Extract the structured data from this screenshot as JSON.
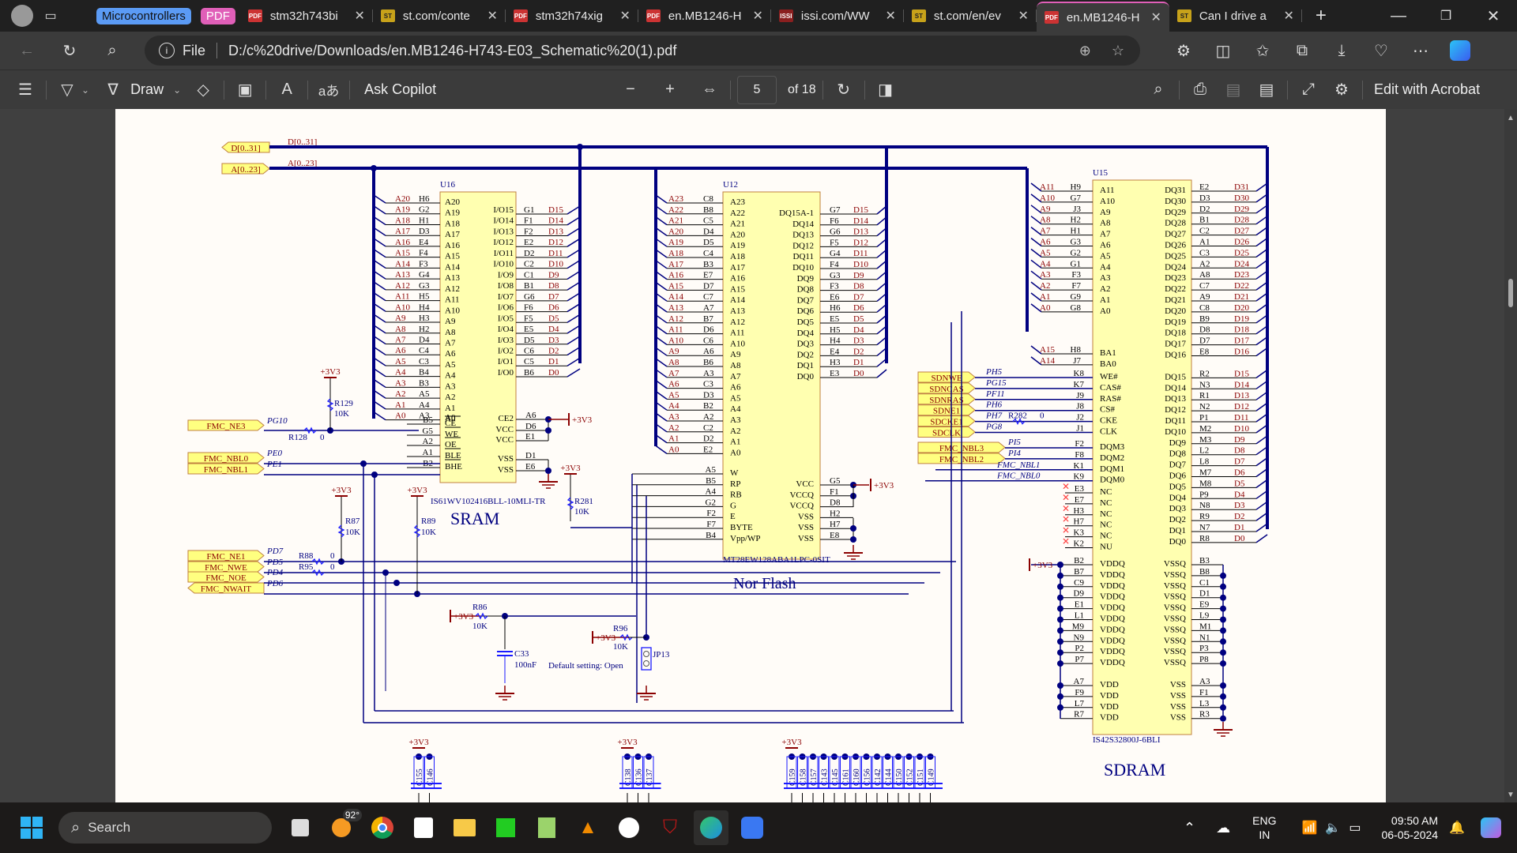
{
  "browser": {
    "tab_groups": [
      {
        "label": "Microcontrollers",
        "color": "#5b9bf5"
      },
      {
        "label": "PDF",
        "color": "#e05fb8"
      }
    ],
    "tabs": [
      {
        "title": "stm32h743bi",
        "icon": "pdf-icon",
        "active": false
      },
      {
        "title": "st.com/conte",
        "icon": "st-logo-icon",
        "active": false
      },
      {
        "title": "stm32h74xig",
        "icon": "pdf-icon",
        "active": false
      },
      {
        "title": "en.MB1246-H",
        "icon": "pdf-icon",
        "active": false
      },
      {
        "title": "issi.com/WW",
        "icon": "issi-logo-icon",
        "active": false
      },
      {
        "title": "st.com/en/ev",
        "icon": "st-logo-icon",
        "active": false
      },
      {
        "title": "en.MB1246-H",
        "icon": "pdf-icon",
        "active": true
      },
      {
        "title": "Can I drive a",
        "icon": "st-logo-icon",
        "active": false
      }
    ],
    "address": {
      "scheme_label": "File",
      "url": "D:/c%20drive/Downloads/en.MB1246-H743-E03_Schematic%20(1).pdf"
    }
  },
  "pdf_toolbar": {
    "draw_label": "Draw",
    "ask_copilot_label": "Ask Copilot",
    "page_current": "5",
    "page_total_label": "of 18",
    "edit_label": "Edit with Acrobat"
  },
  "schematic": {
    "bus_ports": {
      "data": "D[0..31]",
      "addr": "A[0..23]"
    },
    "sram": {
      "ref": "U16",
      "part": "IS61WV102416BLL-10MLI-TR",
      "title": "SRAM",
      "addr_pins": [
        [
          "A20",
          "H6"
        ],
        [
          "A19",
          "G2"
        ],
        [
          "A18",
          "H1"
        ],
        [
          "A17",
          "D3"
        ],
        [
          "A16",
          "E4"
        ],
        [
          "A15",
          "F4"
        ],
        [
          "A14",
          "F3"
        ],
        [
          "A13",
          "G4"
        ],
        [
          "A12",
          "G3"
        ],
        [
          "A11",
          "H5"
        ],
        [
          "A10",
          "H4"
        ],
        [
          "A9",
          "H3"
        ],
        [
          "A8",
          "H2"
        ],
        [
          "A7",
          "D4"
        ],
        [
          "A6",
          "C4"
        ],
        [
          "A5",
          "C3"
        ],
        [
          "A4",
          "B4"
        ],
        [
          "A3",
          "B3"
        ],
        [
          "A2",
          "A5"
        ],
        [
          "A1",
          "A4"
        ],
        [
          "A0",
          "A3"
        ]
      ],
      "data_pins": [
        [
          "I/O15",
          "G1",
          "D15"
        ],
        [
          "I/O14",
          "F1",
          "D14"
        ],
        [
          "I/O13",
          "F2",
          "D13"
        ],
        [
          "I/O12",
          "E2",
          "D12"
        ],
        [
          "I/O11",
          "D2",
          "D11"
        ],
        [
          "I/O10",
          "C2",
          "D10"
        ],
        [
          "I/O9",
          "C1",
          "D9"
        ],
        [
          "I/O8",
          "B1",
          "D8"
        ],
        [
          "I/O7",
          "G6",
          "D7"
        ],
        [
          "I/O6",
          "F6",
          "D6"
        ],
        [
          "I/O5",
          "F5",
          "D5"
        ],
        [
          "I/O4",
          "E5",
          "D4"
        ],
        [
          "I/O3",
          "D5",
          "D3"
        ],
        [
          "I/O2",
          "C6",
          "D2"
        ],
        [
          "I/O1",
          "C5",
          "D1"
        ],
        [
          "I/O0",
          "B6",
          "D0"
        ]
      ],
      "ctrl_pins": [
        [
          "CE",
          "B5"
        ],
        [
          "WE",
          "G5"
        ],
        [
          "OE",
          "A2"
        ],
        [
          "BLE",
          "A1"
        ],
        [
          "BHE",
          "B2"
        ]
      ],
      "pwr_pins": [
        [
          "CE2",
          "A6"
        ],
        [
          "VCC",
          "D6"
        ],
        [
          "VCC",
          "E1"
        ],
        [
          "VSS",
          "D1"
        ],
        [
          "VSS",
          "E6"
        ]
      ]
    },
    "nor": {
      "ref": "U12",
      "part": "MT28EW128ABA1LPC-0SIT",
      "title": "Nor Flash",
      "addr_pins": [
        [
          "A23",
          "C8"
        ],
        [
          "A22",
          "B8"
        ],
        [
          "A21",
          "C5"
        ],
        [
          "A20",
          "D4"
        ],
        [
          "A19",
          "D5"
        ],
        [
          "A18",
          "C4"
        ],
        [
          "A17",
          "B3"
        ],
        [
          "A16",
          "E7"
        ],
        [
          "A15",
          "D7"
        ],
        [
          "A14",
          "C7"
        ],
        [
          "A13",
          "A7"
        ],
        [
          "A12",
          "B7"
        ],
        [
          "A11",
          "D6"
        ],
        [
          "A10",
          "C6"
        ],
        [
          "A9",
          "A6"
        ],
        [
          "A8",
          "B6"
        ],
        [
          "A7",
          "A3"
        ],
        [
          "A6",
          "C3"
        ],
        [
          "A5",
          "D3"
        ],
        [
          "A4",
          "B2"
        ],
        [
          "A3",
          "A2"
        ],
        [
          "A2",
          "C2"
        ],
        [
          "A1",
          "D2"
        ],
        [
          "A0",
          "E2"
        ]
      ],
      "data_pins": [
        [
          "DQ15A-1",
          "G7",
          "D15"
        ],
        [
          "DQ14",
          "F6",
          "D14"
        ],
        [
          "DQ13",
          "G6",
          "D13"
        ],
        [
          "DQ12",
          "F5",
          "D12"
        ],
        [
          "DQ11",
          "G4",
          "D11"
        ],
        [
          "DQ10",
          "F4",
          "D10"
        ],
        [
          "DQ9",
          "G3",
          "D9"
        ],
        [
          "DQ8",
          "F3",
          "D8"
        ],
        [
          "DQ7",
          "E6",
          "D7"
        ],
        [
          "DQ6",
          "H6",
          "D6"
        ],
        [
          "DQ5",
          "E5",
          "D5"
        ],
        [
          "DQ4",
          "H5",
          "D4"
        ],
        [
          "DQ3",
          "H4",
          "D3"
        ],
        [
          "DQ2",
          "E4",
          "D2"
        ],
        [
          "DQ1",
          "H3",
          "D1"
        ],
        [
          "DQ0",
          "E3",
          "D0"
        ]
      ],
      "ctrl_pins": [
        [
          "W",
          "A5"
        ],
        [
          "RP",
          "B5"
        ],
        [
          "RB",
          "A4"
        ],
        [
          "G",
          "G2"
        ],
        [
          "E",
          "F2"
        ],
        [
          "BYTE",
          "F7"
        ],
        [
          "Vpp/WP",
          "B4"
        ]
      ],
      "pwr_pins": [
        [
          "VCC",
          "G5"
        ],
        [
          "VCCQ",
          "F1"
        ],
        [
          "VCCQ",
          "D8"
        ],
        [
          "VSS",
          "H2"
        ],
        [
          "VSS",
          "H7"
        ],
        [
          "VSS",
          "E8"
        ]
      ]
    },
    "sdram": {
      "ref": "U15",
      "part": "IS42S32800J-6BLI",
      "title": "SDRAM",
      "addr_pins": [
        [
          "A11",
          "H9"
        ],
        [
          "A10",
          "G7"
        ],
        [
          "A9",
          "J3"
        ],
        [
          "A8",
          "H2"
        ],
        [
          "A7",
          "H1"
        ],
        [
          "A6",
          "G3"
        ],
        [
          "A5",
          "G2"
        ],
        [
          "A4",
          "G1"
        ],
        [
          "A3",
          "F3"
        ],
        [
          "A2",
          "F7"
        ],
        [
          "A1",
          "G9"
        ],
        [
          "A0",
          "G8"
        ]
      ],
      "bank_pins": [
        [
          "BA1",
          "H8",
          "A15"
        ],
        [
          "BA0",
          "J7",
          "A14"
        ]
      ],
      "data_pins": [
        [
          "DQ31",
          "E2",
          "D31"
        ],
        [
          "DQ30",
          "D3",
          "D30"
        ],
        [
          "DQ29",
          "D2",
          "D29"
        ],
        [
          "DQ28",
          "B1",
          "D28"
        ],
        [
          "DQ27",
          "C2",
          "D27"
        ],
        [
          "DQ26",
          "A1",
          "D26"
        ],
        [
          "DQ25",
          "C3",
          "D25"
        ],
        [
          "DQ24",
          "A2",
          "D24"
        ],
        [
          "DQ23",
          "A8",
          "D23"
        ],
        [
          "DQ22",
          "C7",
          "D22"
        ],
        [
          "DQ21",
          "A9",
          "D21"
        ],
        [
          "DQ20",
          "C8",
          "D20"
        ],
        [
          "DQ19",
          "B9",
          "D19"
        ],
        [
          "DQ18",
          "D8",
          "D18"
        ],
        [
          "DQ17",
          "D7",
          "D17"
        ],
        [
          "DQ16",
          "E8",
          "D16"
        ],
        [
          "DQ15",
          "R2",
          "D15"
        ],
        [
          "DQ14",
          "N3",
          "D14"
        ],
        [
          "DQ13",
          "R1",
          "D13"
        ],
        [
          "DQ12",
          "N2",
          "D12"
        ],
        [
          "DQ11",
          "P1",
          "D11"
        ],
        [
          "DQ10",
          "M2",
          "D10"
        ],
        [
          "DQ9",
          "M3",
          "D9"
        ],
        [
          "DQ8",
          "L2",
          "D8"
        ],
        [
          "DQ7",
          "L8",
          "D7"
        ],
        [
          "DQ6",
          "M7",
          "D6"
        ],
        [
          "DQ5",
          "M8",
          "D5"
        ],
        [
          "DQ4",
          "P9",
          "D4"
        ],
        [
          "DQ3",
          "N8",
          "D3"
        ],
        [
          "DQ2",
          "R9",
          "D2"
        ],
        [
          "DQ1",
          "N7",
          "D1"
        ],
        [
          "DQ0",
          "R8",
          "D0"
        ]
      ],
      "ctrl_pins": [
        [
          "WE#",
          "K8",
          "SDNWE",
          "PH5"
        ],
        [
          "CAS#",
          "K7",
          "SDNCAS",
          "PG15"
        ],
        [
          "RAS#",
          "J9",
          "SDNRAS",
          "PF11"
        ],
        [
          "CS#",
          "J8",
          "SDNE1",
          "PH6"
        ],
        [
          "CKE",
          "J2",
          "SDCKE1",
          "PH7"
        ],
        [
          "CLK",
          "J1",
          "SDCLK",
          "PG8"
        ]
      ],
      "dqm_pins": [
        [
          "DQM3",
          "F2",
          "FMC_NBL3",
          "PI5"
        ],
        [
          "DQM2",
          "F8",
          "FMC_NBL2",
          "PI4"
        ],
        [
          "DQM1",
          "K1",
          "FMC_NBL1",
          ""
        ],
        [
          "DQM0",
          "K9",
          "FMC_NBL0",
          ""
        ]
      ],
      "nc_pins": [
        [
          "NC",
          "E3"
        ],
        [
          "NC",
          "E7"
        ],
        [
          "NC",
          "H3"
        ],
        [
          "NC",
          "H7"
        ],
        [
          "NC",
          "K3"
        ],
        [
          "NU",
          "K2"
        ]
      ],
      "vddq_pins": [
        "B2",
        "B7",
        "C9",
        "D9",
        "E1",
        "L1",
        "M9",
        "N9",
        "P2",
        "P7"
      ],
      "vssq_pins": [
        "B3",
        "B8",
        "C1",
        "D1",
        "E9",
        "L9",
        "M1",
        "N1",
        "P3",
        "P8"
      ],
      "vdd_pins": [
        "A7",
        "F9",
        "L7",
        "R7"
      ],
      "vss_pins": [
        "A3",
        "F1",
        "L3",
        "R3"
      ]
    },
    "ports": [
      {
        "label": "FMC_NE3",
        "pin": "PG10"
      },
      {
        "label": "FMC_NBL0",
        "pin": "PE0"
      },
      {
        "label": "FMC_NBL1",
        "pin": "PE1"
      },
      {
        "label": "FMC_NE1",
        "pin": "PD7"
      },
      {
        "label": "FMC_NWE",
        "pin": "PD5"
      },
      {
        "label": "FMC_NOE",
        "pin": "PD4"
      },
      {
        "label": "FMC_NWAIT",
        "pin": "PD6"
      }
    ],
    "passives": {
      "r128": {
        "ref": "R128",
        "value": "0"
      },
      "r129": {
        "ref": "R129",
        "value": "10K"
      },
      "r87": {
        "ref": "R87",
        "value": "10K"
      },
      "r89": {
        "ref": "R89",
        "value": "10K"
      },
      "r88": {
        "ref": "R88",
        "value": "0"
      },
      "r95": {
        "ref": "R95",
        "value": "0"
      },
      "r281": {
        "ref": "R281",
        "value": "10K"
      },
      "r86": {
        "ref": "R86",
        "value": "10K"
      },
      "r96": {
        "ref": "R96",
        "value": "10K"
      },
      "r282": {
        "ref": "R282",
        "value": "0"
      },
      "c33": {
        "ref": "C33",
        "value": "100nF"
      },
      "jp13": {
        "ref": "JP13",
        "note": "Default setting: Open"
      }
    },
    "power_label": "+3V3",
    "decoupling_groups": [
      [
        "C155",
        "C146"
      ],
      [
        "C138",
        "C136",
        "C137"
      ],
      [
        "C159",
        "C158",
        "C157",
        "C143",
        "C145",
        "C161",
        "C160",
        "C156",
        "C142",
        "C144",
        "C150",
        "C152",
        "C151",
        "C149"
      ]
    ],
    "colors": {
      "wire": "#000080",
      "pin_label": "#8b0000",
      "part_fill": "#ffffb0",
      "port_fill": "#ffff80"
    }
  },
  "taskbar": {
    "search_placeholder": "Search",
    "weather": "92°",
    "apps": [
      "task-view",
      "weather",
      "chrome",
      "microsoft-store",
      "file-explorer",
      "network-app",
      "notepad-plus",
      "vlc",
      "app",
      "mcafee",
      "edge",
      "cloud-app"
    ],
    "lang_line1": "ENG",
    "lang_line2": "IN",
    "time": "09:50 AM",
    "date": "06-05-2024"
  }
}
